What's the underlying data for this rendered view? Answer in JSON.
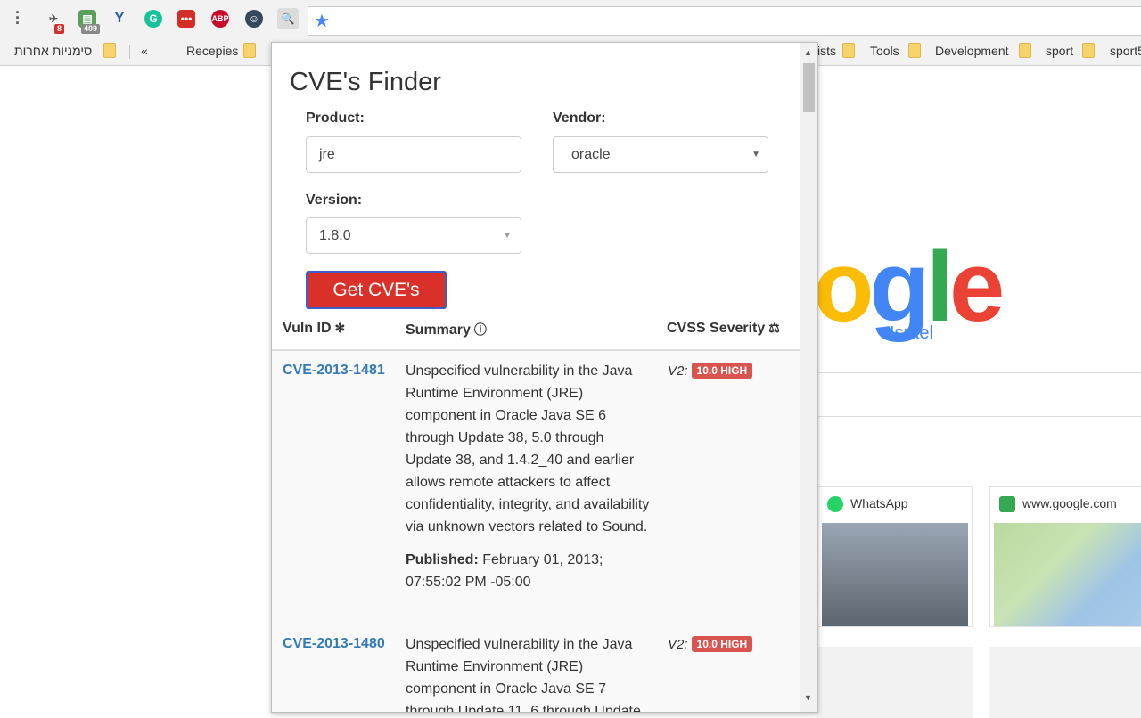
{
  "toolbar": {
    "menu_icon": "vertical-dots-icon",
    "extensions": [
      {
        "name": "airplane-extension-icon",
        "badge": "8"
      },
      {
        "name": "clipboard-extension-icon",
        "badge": "409"
      },
      {
        "name": "yoast-extension-icon",
        "badge": ""
      },
      {
        "name": "grammarly-extension-icon",
        "badge": ""
      },
      {
        "name": "lastpass-extension-icon",
        "badge": ""
      },
      {
        "name": "adblock-plus-extension-icon",
        "badge": ""
      },
      {
        "name": "ghostery-extension-icon",
        "badge": ""
      },
      {
        "name": "magnifier-extension-icon",
        "badge": ""
      }
    ],
    "omnibox_value": ""
  },
  "bookmarks": {
    "other_bookmarks": "סימניות אחרות",
    "overflow": "«",
    "items": [
      "Recepies",
      "ists",
      "Tools",
      "Development",
      "sport",
      "sport5"
    ]
  },
  "google_page": {
    "logo_partial": "ogle",
    "region": "Israel",
    "tiles": [
      {
        "title": "WhatsApp",
        "icon": "whatsapp-icon"
      },
      {
        "title": "www.google.com",
        "icon": "google-maps-icon"
      }
    ]
  },
  "popup": {
    "title": "CVE's Finder",
    "product_label": "Product:",
    "product_value": "jre",
    "vendor_label": "Vendor:",
    "vendor_value": "oracle",
    "version_label": "Version:",
    "version_value": "1.8.0",
    "button_label": "Get CVE's",
    "columns": {
      "vuln_id": "Vuln ID",
      "summary": "Summary",
      "severity": "CVSS Severity"
    },
    "rows": [
      {
        "id": "CVE-2013-1481",
        "summary": "Unspecified vulnerability in the Java Runtime Environment (JRE) component in Oracle Java SE 6 through Update 38, 5.0 through Update 38, and 1.4.2_40 and earlier allows remote attackers to affect confidentiality, integrity, and availability via unknown vectors related to Sound.",
        "published_label": "Published:",
        "published": "February 01, 2013; 07:55:02 PM -05:00",
        "severity_version": "V2:",
        "severity": "10.0 HIGH"
      },
      {
        "id": "CVE-2013-1480",
        "summary": "Unspecified vulnerability in the Java Runtime Environment (JRE) component in Oracle Java SE 7 through Update 11, 6 through Update",
        "published_label": "",
        "published": "",
        "severity_version": "V2:",
        "severity": "10.0 HIGH"
      }
    ]
  },
  "colors": {
    "button": "#d9302a",
    "link": "#337ab7",
    "severity_badge": "#d9534f"
  }
}
